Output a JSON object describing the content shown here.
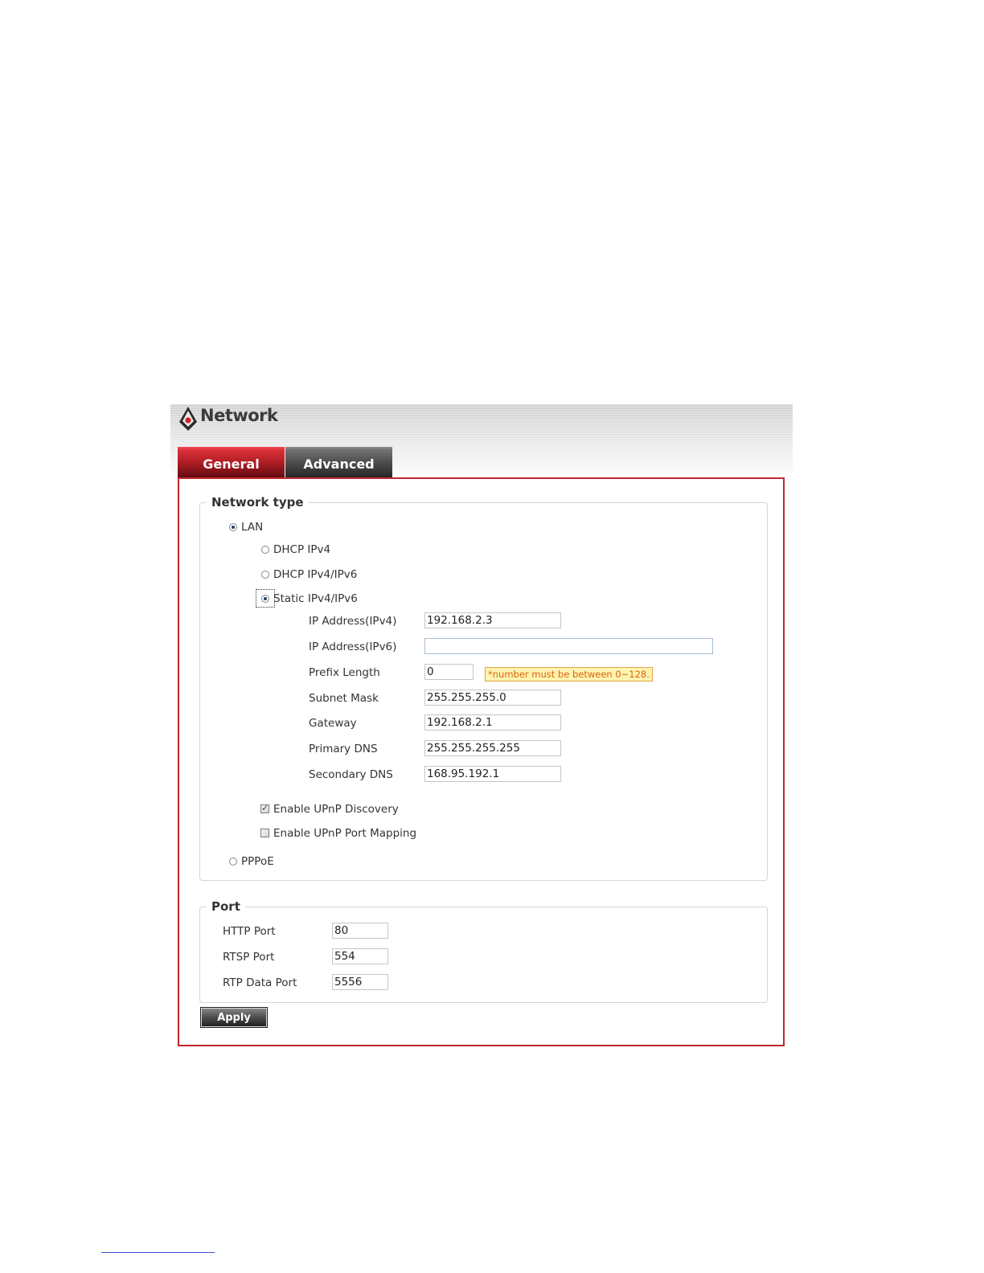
{
  "page": {
    "title": "Network",
    "logo_icon": "camera-brand-logo-icon"
  },
  "tabs": [
    {
      "label": "General",
      "active": true
    },
    {
      "label": "Advanced",
      "active": false
    }
  ],
  "network_type": {
    "legend": "Network type",
    "lan": {
      "label": "LAN",
      "selected": true
    },
    "dhcp_ipv4": {
      "label": "DHCP IPv4",
      "selected": false
    },
    "dhcp_ipv4_ipv6": {
      "label": "DHCP IPv4/IPv6",
      "selected": false
    },
    "static_ipv4_ipv6": {
      "label": "Static IPv4/IPv6",
      "selected": true
    },
    "fields": {
      "ipv4": {
        "label": "IP Address(IPv4)",
        "value": "192.168.2.3"
      },
      "ipv6": {
        "label": "IP Address(IPv6)",
        "value": ""
      },
      "prefix": {
        "label": "Prefix Length",
        "value": "0",
        "hint": "*number must be between 0~128."
      },
      "subnet": {
        "label": "Subnet Mask",
        "value": "255.255.255.0"
      },
      "gateway": {
        "label": "Gateway",
        "value": "192.168.2.1"
      },
      "primary_dns": {
        "label": "Primary DNS",
        "value": "255.255.255.255"
      },
      "secondary_dns": {
        "label": "Secondary DNS",
        "value": "168.95.192.1"
      }
    },
    "upnp_discovery": {
      "label": "Enable UPnP Discovery",
      "checked": true
    },
    "upnp_port_mapping": {
      "label": "Enable UPnP Port Mapping",
      "checked": false
    },
    "pppoe": {
      "label": "PPPoE",
      "selected": false
    }
  },
  "port": {
    "legend": "Port",
    "http": {
      "label": "HTTP Port",
      "value": "80"
    },
    "rtsp": {
      "label": "RTSP Port",
      "value": "554"
    },
    "rtp": {
      "label": "RTP Data Port",
      "value": "5556"
    }
  },
  "apply_label": "Apply",
  "colors": {
    "panel_border": "#c0272d",
    "tab_active": "#b11d25",
    "tab_inactive": "#4e4e4e",
    "hint_bg": "#fff3b0",
    "hint_text": "#d8650e"
  }
}
